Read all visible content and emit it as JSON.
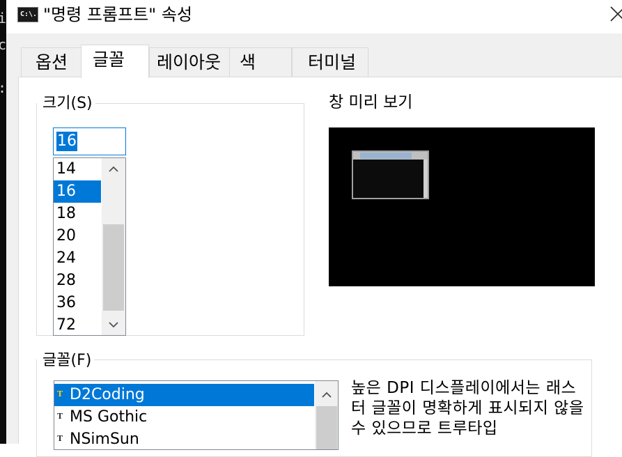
{
  "window": {
    "title": "\"명령 프롬프트\" 속성",
    "icon_label": "C:\\."
  },
  "background_strip": {
    "glyphs": [
      "i",
      "c",
      ":"
    ]
  },
  "tabs": [
    {
      "label": "옵션",
      "active": false
    },
    {
      "label": "글꼴",
      "active": true
    },
    {
      "label": "레이아웃",
      "active": false
    },
    {
      "label": "색",
      "active": false
    },
    {
      "label": "터미널",
      "active": false
    }
  ],
  "size_group": {
    "legend": "크기(S)",
    "input_value": "16",
    "items": [
      "14",
      "16",
      "18",
      "20",
      "24",
      "28",
      "36",
      "72"
    ],
    "selected": "16"
  },
  "preview": {
    "label": "창 미리 보기"
  },
  "font_group": {
    "legend": "글꼴(F)",
    "items": [
      "D2Coding",
      "MS Gothic",
      "NSimSun"
    ],
    "selected": "D2Coding",
    "item_icon": "truetype-icon",
    "note": "높은 DPI 디스플레이에서는 래스터 글꼴이 명확하게 표시되지 않을 수 있으므로 트루타입"
  },
  "colors": {
    "selection": "#0078d7",
    "dialog_bg": "#f0f0f0",
    "panel_bg": "#ffffff",
    "preview_bg": "#000000"
  }
}
